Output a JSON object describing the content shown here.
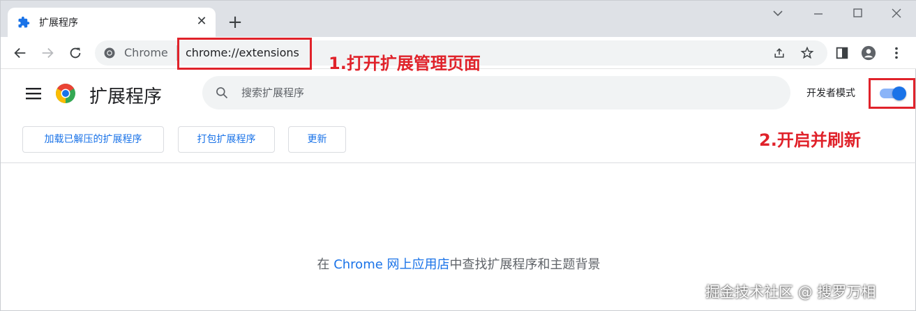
{
  "tab": {
    "title": "扩展程序",
    "icon": "puzzle-icon",
    "close_glyph": "✕"
  },
  "newtab_glyph": "+",
  "omnibox": {
    "chip": "Chrome",
    "url": "chrome://extensions"
  },
  "header": {
    "title": "扩展程序",
    "search_placeholder": "搜索扩展程序",
    "dev_mode_label": "开发者模式",
    "dev_mode_on": true
  },
  "actions": {
    "load_unpacked": "加载已解压的扩展程序",
    "pack": "打包扩展程序",
    "update": "更新"
  },
  "empty_state": {
    "prefix": "在 ",
    "link": "Chrome 网上应用店",
    "suffix": "中查找扩展程序和主题背景"
  },
  "annotations": {
    "step1": "1.打开扩展管理页面",
    "step2": "2.开启并刷新",
    "color": "#e0222a"
  },
  "watermark": "掘金技术社区 @ 搜罗万相",
  "colors": {
    "accent": "#1a73e8",
    "toggle_track": "#8ab4f8",
    "tabstrip_bg": "#dee1e6"
  }
}
